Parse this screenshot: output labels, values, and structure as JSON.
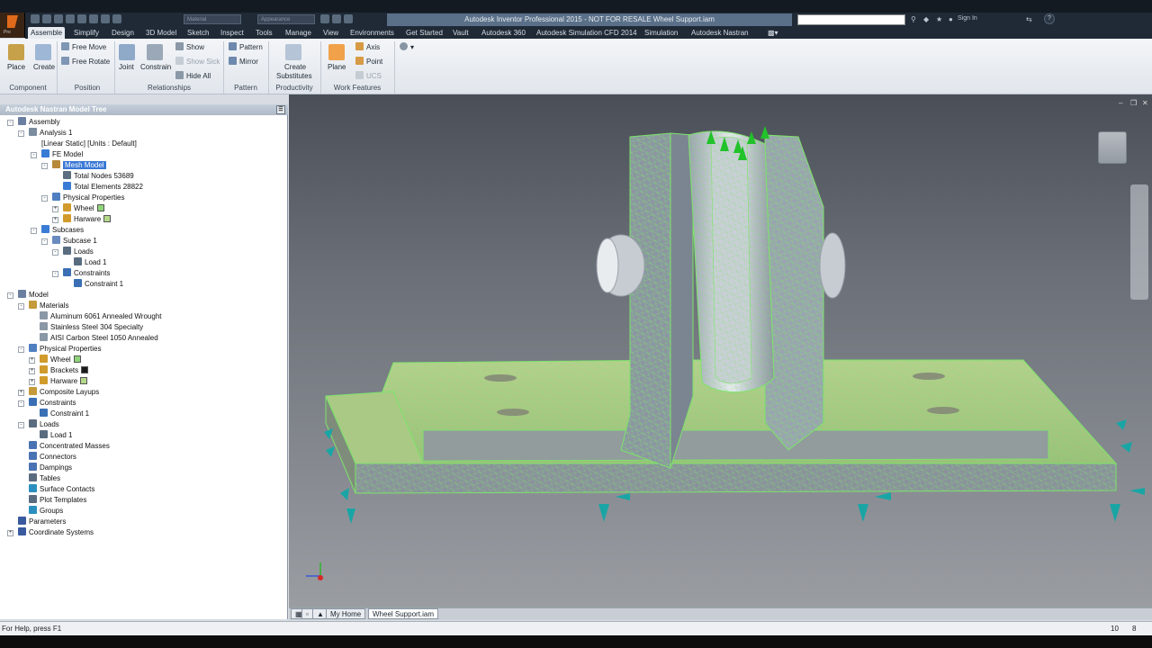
{
  "title_bar": {
    "window_title": "Autodesk Inventor Professional 2015 - NOT FOR RESALE   Wheel Support.iam",
    "material_select": "Material",
    "appearance_select": "Appearance",
    "sign_in": "Sign In"
  },
  "app_button": {
    "label": "Pro"
  },
  "ribbon_tabs": [
    "Assemble",
    "Simplify",
    "Design",
    "3D Model",
    "Sketch",
    "Inspect",
    "Tools",
    "Manage",
    "View",
    "Environments",
    "Get Started",
    "Vault",
    "Autodesk 360",
    "Autodesk Simulation CFD 2014",
    "Simulation",
    "Autodesk Nastran"
  ],
  "ribbon": {
    "component": {
      "place": "Place",
      "create": "Create",
      "panel": "Component"
    },
    "position": {
      "free_move": "Free Move",
      "free_rotate": "Free Rotate",
      "panel": "Position"
    },
    "relationships": {
      "joint": "Joint",
      "constrain": "Constrain",
      "show": "Show",
      "show_sick": "Show Sick",
      "hide_all": "Hide All",
      "panel": "Relationships"
    },
    "pattern": {
      "pattern": "Pattern",
      "mirror": "Mirror",
      "panel": "Pattern"
    },
    "productivity": {
      "create_substitutes_1": "Create",
      "create_substitutes_2": "Substitutes",
      "panel": "Productivity"
    },
    "work_features": {
      "plane": "Plane",
      "axis": "Axis",
      "point": "Point",
      "ucs": "UCS",
      "panel": "Work Features"
    }
  },
  "browser": {
    "title": "Autodesk Nastran Model Tree",
    "nodes": [
      "Assembly",
      "Analysis 1",
      "[Linear Static] [Units : Default]",
      "FE Model",
      "Mesh Model",
      "Total Nodes 53689",
      "Total Elements 28822",
      "Physical Properties",
      "Wheel",
      "Harware",
      "Subcases",
      "Subcase 1",
      "Loads",
      "Load 1",
      "Constraints",
      "Constraint 1",
      "Model",
      "Materials",
      "Aluminum 6061 Annealed Wrought",
      "Stainless Steel 304 Specialty",
      "AISI Carbon Steel 1050 Annealed",
      "Physical Properties",
      "Wheel",
      "Brackets",
      "Harware",
      "Composite Layups",
      "Constraints",
      "Constraint 1",
      "Loads",
      "Load 1",
      "Concentrated Masses",
      "Connectors",
      "Dampings",
      "Tables",
      "Surface Contacts",
      "Plot Templates",
      "Groups",
      "Parameters",
      "Coordinate Systems"
    ]
  },
  "colors": {
    "mesh_green": "#7de36b",
    "constraint_teal": "#1aa5a5",
    "load_green": "#22c22a",
    "selection_blue": "#3a78d6",
    "swatch_wheel": "#8fd47a",
    "swatch_brackets": "#1a1a1a",
    "swatch_harware": "#b5d98a"
  },
  "doc_tabs": {
    "home": "My Home",
    "active": "Wheel Support.iam"
  },
  "status": {
    "help": "For Help, press F1",
    "count_a": "10",
    "count_b": "8"
  }
}
